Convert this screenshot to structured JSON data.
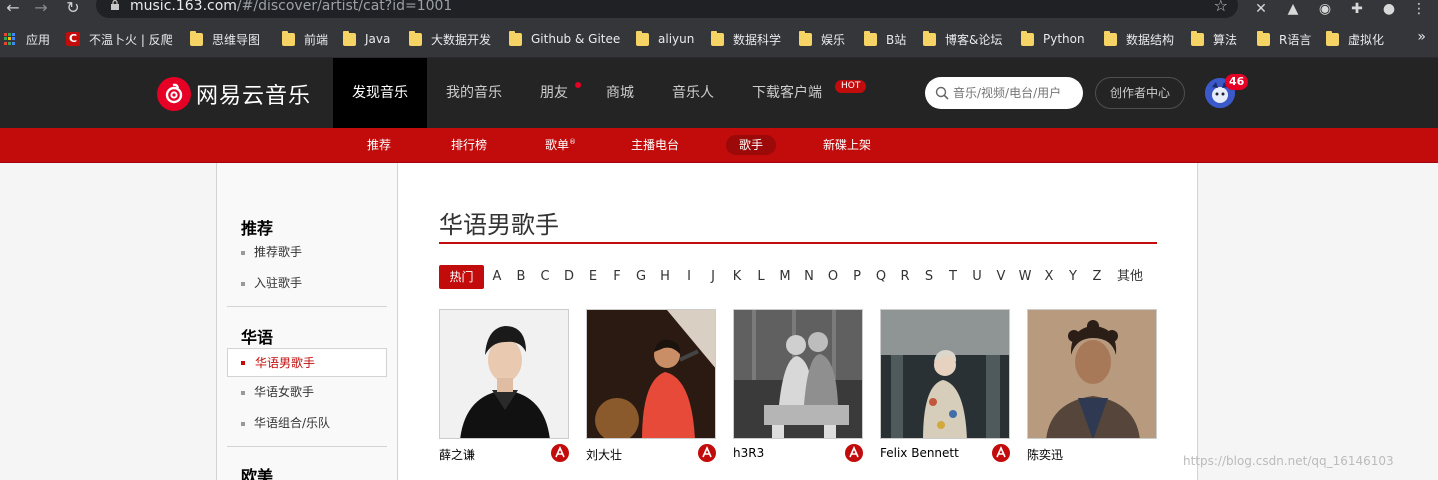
{
  "browser": {
    "url_host": "music.163.com",
    "url_path": "/#/discover/artist/cat?id=1001",
    "bookmarks": [
      {
        "label": "应用",
        "kind": "apps"
      },
      {
        "label": "不温卜火 | 反爬",
        "kind": "c"
      },
      {
        "label": "思维导图",
        "kind": "folder"
      },
      {
        "label": "前端",
        "kind": "folder"
      },
      {
        "label": "Java",
        "kind": "folder"
      },
      {
        "label": "大数据开发",
        "kind": "folder"
      },
      {
        "label": "Github & Gitee",
        "kind": "folder"
      },
      {
        "label": "aliyun",
        "kind": "folder"
      },
      {
        "label": "数据科学",
        "kind": "folder"
      },
      {
        "label": "娱乐",
        "kind": "folder"
      },
      {
        "label": "B站",
        "kind": "folder"
      },
      {
        "label": "博客&论坛",
        "kind": "folder"
      },
      {
        "label": "Python",
        "kind": "folder"
      },
      {
        "label": "数据结构",
        "kind": "folder"
      },
      {
        "label": "算法",
        "kind": "folder"
      },
      {
        "label": "R语言",
        "kind": "folder"
      },
      {
        "label": "虚拟化",
        "kind": "folder"
      }
    ],
    "more": "»"
  },
  "topnav": {
    "logo_text": "网易云音乐",
    "items": [
      "发现音乐",
      "我的音乐",
      "朋友",
      "商城",
      "音乐人",
      "下载客户端"
    ],
    "hot_badge": "HOT",
    "search_placeholder": "音乐/视频/电台/用户",
    "creator_center": "创作者中心",
    "message_count": "46"
  },
  "subnav": {
    "items": [
      "推荐",
      "排行榜",
      "歌单",
      "主播电台",
      "歌手",
      "新碟上架"
    ],
    "reg": "®"
  },
  "sidebar": {
    "sections": [
      {
        "title": "推荐",
        "items": [
          "推荐歌手",
          "入驻歌手"
        ]
      },
      {
        "title": "华语",
        "items": [
          "华语男歌手",
          "华语女歌手",
          "华语组合/乐队"
        ]
      },
      {
        "title": "欧美",
        "items": []
      }
    ]
  },
  "main": {
    "title": "华语男歌手",
    "letters": [
      "热门",
      "A",
      "B",
      "C",
      "D",
      "E",
      "F",
      "G",
      "H",
      "I",
      "J",
      "K",
      "L",
      "M",
      "N",
      "O",
      "P",
      "Q",
      "R",
      "S",
      "T",
      "U",
      "V",
      "W",
      "X",
      "Y",
      "Z",
      "其他"
    ],
    "artists": [
      "薛之谦",
      "刘大壮",
      "h3R3",
      "Felix Bennett",
      "陈奕迅"
    ]
  },
  "watermark": "https://blog.csdn.net/qq_16146103",
  "colors": {
    "brand_red": "#c20c0c",
    "nav_dark": "#242424"
  }
}
